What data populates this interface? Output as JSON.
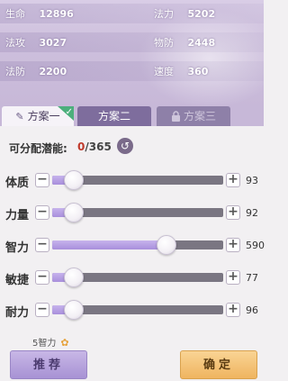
{
  "stats": {
    "row1": [
      {
        "label": "生命",
        "value": "12896"
      },
      {
        "label": "法力",
        "value": "5202"
      }
    ],
    "row2": [
      {
        "label": "法攻",
        "value": "3027"
      },
      {
        "label": "物防",
        "value": "2448"
      }
    ],
    "row3": [
      {
        "label": "法防",
        "value": "2200"
      },
      {
        "label": "速度",
        "value": "360"
      }
    ]
  },
  "tabs": [
    {
      "label": "方案一",
      "active": true,
      "locked": false
    },
    {
      "label": "方案二",
      "active": false,
      "locked": false
    },
    {
      "label": "方案三",
      "active": false,
      "locked": true
    }
  ],
  "points": {
    "label": "可分配潜能:",
    "current": "0",
    "total": "/365"
  },
  "attributes": [
    {
      "label": "体质",
      "value": "93",
      "level": 0.0
    },
    {
      "label": "力量",
      "value": "92",
      "level": 0.0
    },
    {
      "label": "智力",
      "value": "590",
      "level": 0.62
    },
    {
      "label": "敏捷",
      "value": "77",
      "level": 0.0
    },
    {
      "label": "耐力",
      "value": "96",
      "level": 0.0
    }
  ],
  "hint": {
    "text": "5智力"
  },
  "buttons": {
    "recommend": "推荐",
    "confirm": "确定"
  },
  "colors": {
    "accent_fill": "#b49be2",
    "confirm": "#f3c173",
    "recommend": "#b9a4dc",
    "points_current": "#c0392b"
  }
}
